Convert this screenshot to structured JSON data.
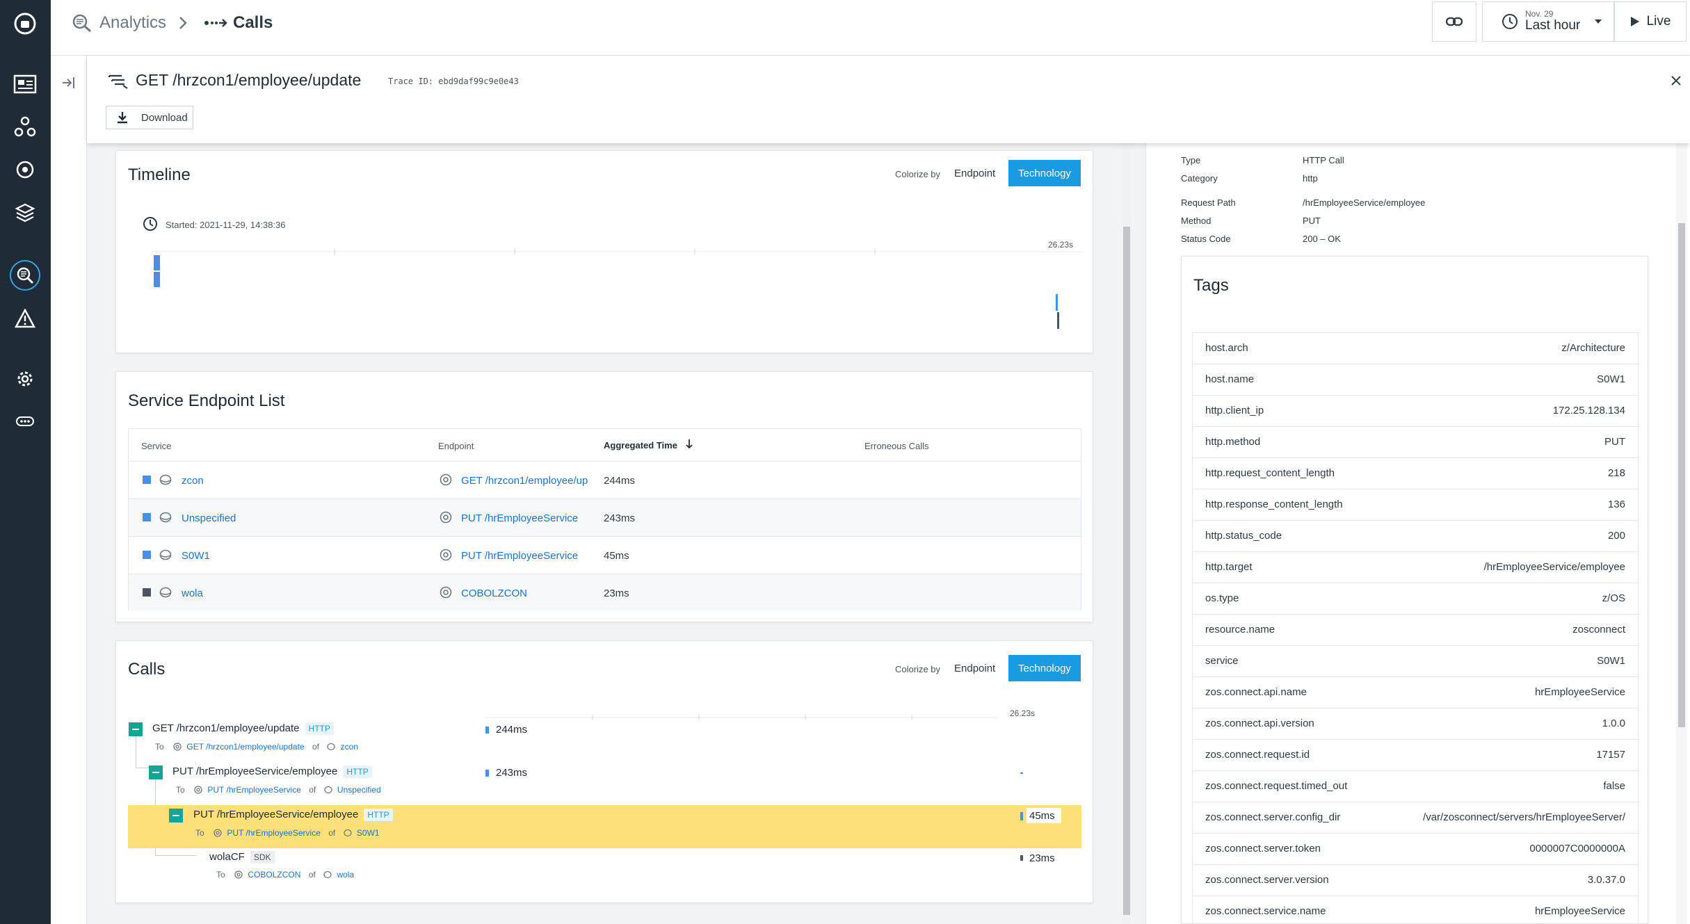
{
  "header": {
    "breadcrumb_app": "Analytics",
    "breadcrumb_page": "Calls",
    "date_top": "Nov. 29",
    "date_range": "Last hour",
    "live_label": "Live"
  },
  "trace": {
    "title": "GET /hrzcon1/employee/update",
    "trace_id": "Trace ID: ebd9daf99c9e0e43",
    "download_label": "Download"
  },
  "timeline": {
    "title": "Timeline",
    "colorize_label": "Colorize by",
    "endpoint_label": "Endpoint",
    "technology_label": "Technology",
    "started": "Started: 2021-11-29, 14:38:36",
    "end_label": "26.23s"
  },
  "endpoints": {
    "title": "Service Endpoint List",
    "columns": [
      "Service",
      "Endpoint",
      "Aggregated Time",
      "Erroneous Calls"
    ],
    "rows": [
      {
        "service": "zcon",
        "endpoint": "GET /hrzcon1/employee/up",
        "time": "244ms",
        "color": "#4a90e2"
      },
      {
        "service": "Unspecified",
        "endpoint": "PUT /hrEmployeeService",
        "time": "243ms",
        "color": "#4a90e2"
      },
      {
        "service": "S0W1",
        "endpoint": "PUT /hrEmployeeService",
        "time": "45ms",
        "color": "#4a90e2"
      },
      {
        "service": "wola",
        "endpoint": "COBOLZCON",
        "time": "23ms",
        "color": "#4a5561"
      }
    ]
  },
  "calls": {
    "title": "Calls",
    "colorize_label": "Colorize by",
    "endpoint_label": "Endpoint",
    "technology_label": "Technology",
    "end_label": "26.23s",
    "to_label": "To",
    "of_label": "of",
    "items": [
      {
        "name": "GET /hrzcon1/employee/update",
        "badge": "HTTP",
        "to": "GET /hrzcon1/employee/update",
        "of": "zcon",
        "duration": "244ms"
      },
      {
        "name": "PUT /hrEmployeeService/employee",
        "badge": "HTTP",
        "to": "PUT /hrEmployeeService",
        "of": "Unspecified",
        "duration": "243ms"
      },
      {
        "name": "PUT /hrEmployeeService/employee",
        "badge": "HTTP",
        "to": "PUT /hrEmployeeService",
        "of": "S0W1",
        "duration": "45ms"
      },
      {
        "name": "wolaCF",
        "badge": "SDK",
        "to": "COBOLZCON",
        "of": "wola",
        "duration": "23ms"
      }
    ]
  },
  "details": {
    "rows": [
      {
        "key": "Type",
        "value": "HTTP Call"
      },
      {
        "key": "Category",
        "value": "http"
      },
      {
        "key": "Request Path",
        "value": "/hrEmployeeService/employee"
      },
      {
        "key": "Method",
        "value": "PUT"
      },
      {
        "key": "Status Code",
        "value": "200 – OK"
      }
    ]
  },
  "tags": {
    "title": "Tags",
    "rows": [
      {
        "key": "host.arch",
        "value": "z/Architecture"
      },
      {
        "key": "host.name",
        "value": "S0W1"
      },
      {
        "key": "http.client_ip",
        "value": "172.25.128.134"
      },
      {
        "key": "http.method",
        "value": "PUT"
      },
      {
        "key": "http.request_content_length",
        "value": "218"
      },
      {
        "key": "http.response_content_length",
        "value": "136"
      },
      {
        "key": "http.status_code",
        "value": "200"
      },
      {
        "key": "http.target",
        "value": "/hrEmployeeService/employee"
      },
      {
        "key": "os.type",
        "value": "z/OS"
      },
      {
        "key": "resource.name",
        "value": "zosconnect"
      },
      {
        "key": "service",
        "value": "S0W1"
      },
      {
        "key": "zos.connect.api.name",
        "value": "hrEmployeeService"
      },
      {
        "key": "zos.connect.api.version",
        "value": "1.0.0"
      },
      {
        "key": "zos.connect.request.id",
        "value": "17157"
      },
      {
        "key": "zos.connect.request.timed_out",
        "value": "false"
      },
      {
        "key": "zos.connect.server.config_dir",
        "value": "/var/zosconnect/servers/hrEmployeeServer/"
      },
      {
        "key": "zos.connect.server.token",
        "value": "0000007C0000000A"
      },
      {
        "key": "zos.connect.server.version",
        "value": "3.0.37.0"
      },
      {
        "key": "zos.connect.service.name",
        "value": "hrEmployeeService"
      }
    ]
  },
  "colors": {
    "accent": "#1a9ae0",
    "nav_bg": "#1f2b36",
    "highlight_row": "#fde07a",
    "tree_toggle": "#14a495"
  }
}
